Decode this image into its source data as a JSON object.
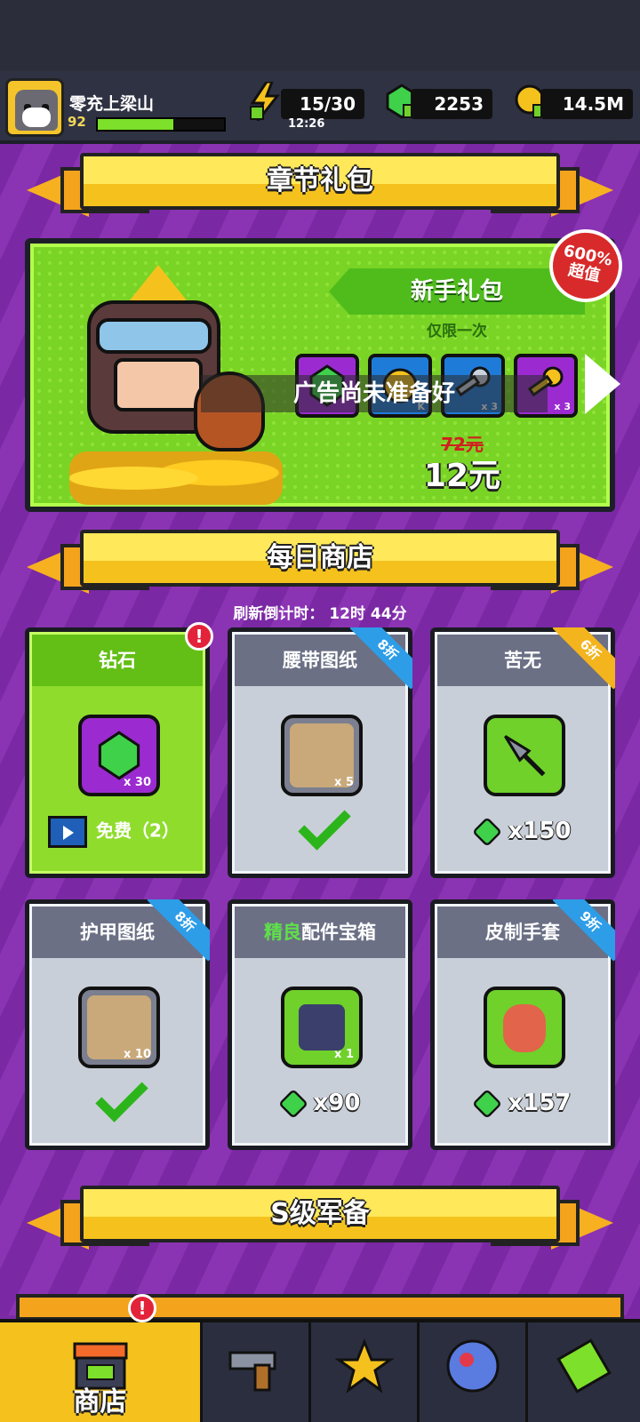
{
  "header": {
    "player_name": "零充上梁山",
    "level": "92",
    "xp_fraction": 0.6,
    "energy": "15/30",
    "energy_timer": "12:26",
    "gems": "2253",
    "coins": "14.5M"
  },
  "sections": {
    "chapter_pack": "章节礼包",
    "daily_shop": "每日商店",
    "s_gear": "S级军备"
  },
  "chapter_pack": {
    "name": "新手礼包",
    "limit": "仅限一次",
    "ad_message": "广告尚未准备好",
    "old_price": "72元",
    "new_price": "12元",
    "value_badge_line1": "600%",
    "value_badge_line2": "超值",
    "rewards": [
      {
        "icon": "gem-icon",
        "qty": ""
      },
      {
        "icon": "coin-icon",
        "qty": "K"
      },
      {
        "icon": "silver-key-icon",
        "qty": "x 3"
      },
      {
        "icon": "gold-key-icon",
        "qty": "x 3"
      }
    ]
  },
  "daily_shop": {
    "refresh_label": "刷新倒计时： 12时 44分",
    "items": [
      {
        "title": "钻石",
        "qty": "x 30",
        "price": "免费（2）",
        "ad_tag": "广告",
        "discount": "",
        "status": "free"
      },
      {
        "title": "腰带图纸",
        "qty": "x 5",
        "price": "",
        "discount": "8折",
        "status": "purchased"
      },
      {
        "title": "苦无",
        "qty": "",
        "price": "x150",
        "discount": "6折",
        "status": "gems"
      },
      {
        "title": "护甲图纸",
        "qty": "x 10",
        "price": "",
        "discount": "8折",
        "status": "purchased"
      },
      {
        "title_prefix": "精良",
        "title": "配件宝箱",
        "qty": "x 1",
        "price": "x90",
        "discount": "",
        "status": "gems"
      },
      {
        "title": "皮制手套",
        "qty": "",
        "price": "x157",
        "discount": "9折",
        "status": "gems"
      }
    ]
  },
  "nav": {
    "shop": "商店",
    "items": [
      "shop-icon",
      "weapon-icon",
      "battle-icon",
      "talent-orb-icon",
      "evolution-icon"
    ]
  },
  "colors": {
    "accent": "#f5c21d",
    "background": "#7c2aa6",
    "green": "#7ad425"
  }
}
